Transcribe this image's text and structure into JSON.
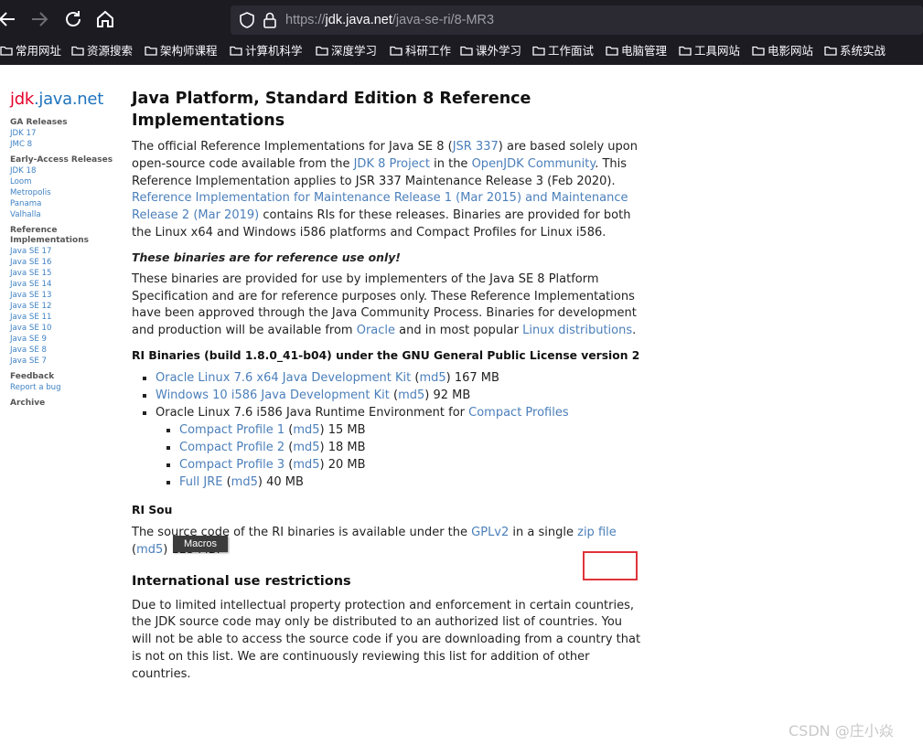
{
  "browser": {
    "url_prefix": "https://",
    "url_domain": "jdk.java.net",
    "url_path": "/java-se-ri/8-MR3",
    "bookmarks": [
      "常用网址",
      "资源搜索",
      "架构师课程",
      "计算机科学",
      "深度学习",
      "科研工作",
      "课外学习",
      "工作面试",
      "电脑管理",
      "工具网站",
      "电影网站",
      "系统实战"
    ]
  },
  "sidebar": {
    "brand_jdk": "jdk",
    "brand_dot": ".",
    "brand_rest": "java.net",
    "ga_head": "GA Releases",
    "ga_links": [
      "JDK 17",
      "JMC 8"
    ],
    "ea_head": "Early-Access Releases",
    "ea_links": [
      "JDK 18",
      "Loom",
      "Metropolis",
      "Panama",
      "Valhalla"
    ],
    "ri_head": "Reference Implementations",
    "ri_links": [
      "Java SE 17",
      "Java SE 16",
      "Java SE 15",
      "Java SE 14",
      "Java SE 13",
      "Java SE 12",
      "Java SE 11",
      "Java SE 10",
      "Java SE 9",
      "Java SE 8",
      "Java SE 7"
    ],
    "feedback_head": "Feedback",
    "report_bug": "Report a bug",
    "archive": "Archive"
  },
  "main": {
    "title": "Java Platform, Standard Edition 8 Reference Implementations",
    "intro": {
      "t1": "The official Reference Implementations for Java SE 8 (",
      "jsr": "JSR 337",
      "t2": ") are based solely upon open-source code available from the ",
      "jdk8": "JDK 8 Project",
      "t3": " in the ",
      "openjdk": "OpenJDK Community",
      "t4": ". This Reference Implementation applies to JSR 337 Maintenance Release 3 (Feb 2020). ",
      "ri_link": "Reference Implementation for Maintenance Release 1 (Mar 2015) and Maintenance Release 2 (Mar 2019)",
      "t5": " contains RIs for these releases. Binaries are provided for both the Linux x64 and Windows i586 platforms and Compact Profiles for Linux i586."
    },
    "notice": "These binaries are for reference use only!",
    "para2": {
      "t1": "These binaries are provided for use by implementers of the Java SE 8 Platform Specification and are for reference purposes only. These Reference Implementations have been approved through the Java Community Process. Binaries for development and production will be available from ",
      "oracle": "Oracle",
      "t2": " and in most popular ",
      "linux": "Linux distributions",
      "t3": "."
    },
    "binaries_heading": "RI Binaries (build 1.8.0_41-b04) under the GNU General Public License version 2",
    "items": {
      "oracle_linux_jdk": "Oracle Linux 7.6 x64 Java Development Kit",
      "windows_jdk": "Windows 10 i586 Java Development Kit",
      "jre_text": "Oracle Linux 7.6 i586 Java Runtime Environment for ",
      "compact_profiles": "Compact Profiles",
      "cp1": "Compact Profile 1",
      "cp2": "Compact Profile 2",
      "cp3": "Compact Profile 3",
      "full_jre": "Full JRE",
      "md5": "md5",
      "open_paren": " (",
      "size_167": ") 167 MB",
      "size_92": ") 92 MB",
      "size_15": ") 15 MB",
      "size_18": ") 18 MB",
      "size_20": ") 20 MB",
      "size_40": ") 40 MB"
    },
    "source_heading": "RI Sou",
    "source": {
      "t1": "The source code of the RI binaries is available under the ",
      "gpl": "GPLv2",
      "t2": " in a single ",
      "zip": "zip file",
      "t3": "(",
      "md5": "md5",
      "t4": ") 123 MB."
    },
    "intl_heading": "International use restrictions",
    "intl_text": "Due to limited intellectual property protection and enforcement in certain countries, the JDK source code may only be distributed to an authorized list of countries. You will not be able to access the source code if you are downloading from a country that is not on this list. We are continuously reviewing this list for addition of other countries."
  },
  "tooltip": "Macros",
  "watermark": "CSDN @庄小焱",
  "colors": {
    "link": "#4b7fba",
    "highlight": "#e0333a",
    "browser_bg": "#1c1b22"
  }
}
